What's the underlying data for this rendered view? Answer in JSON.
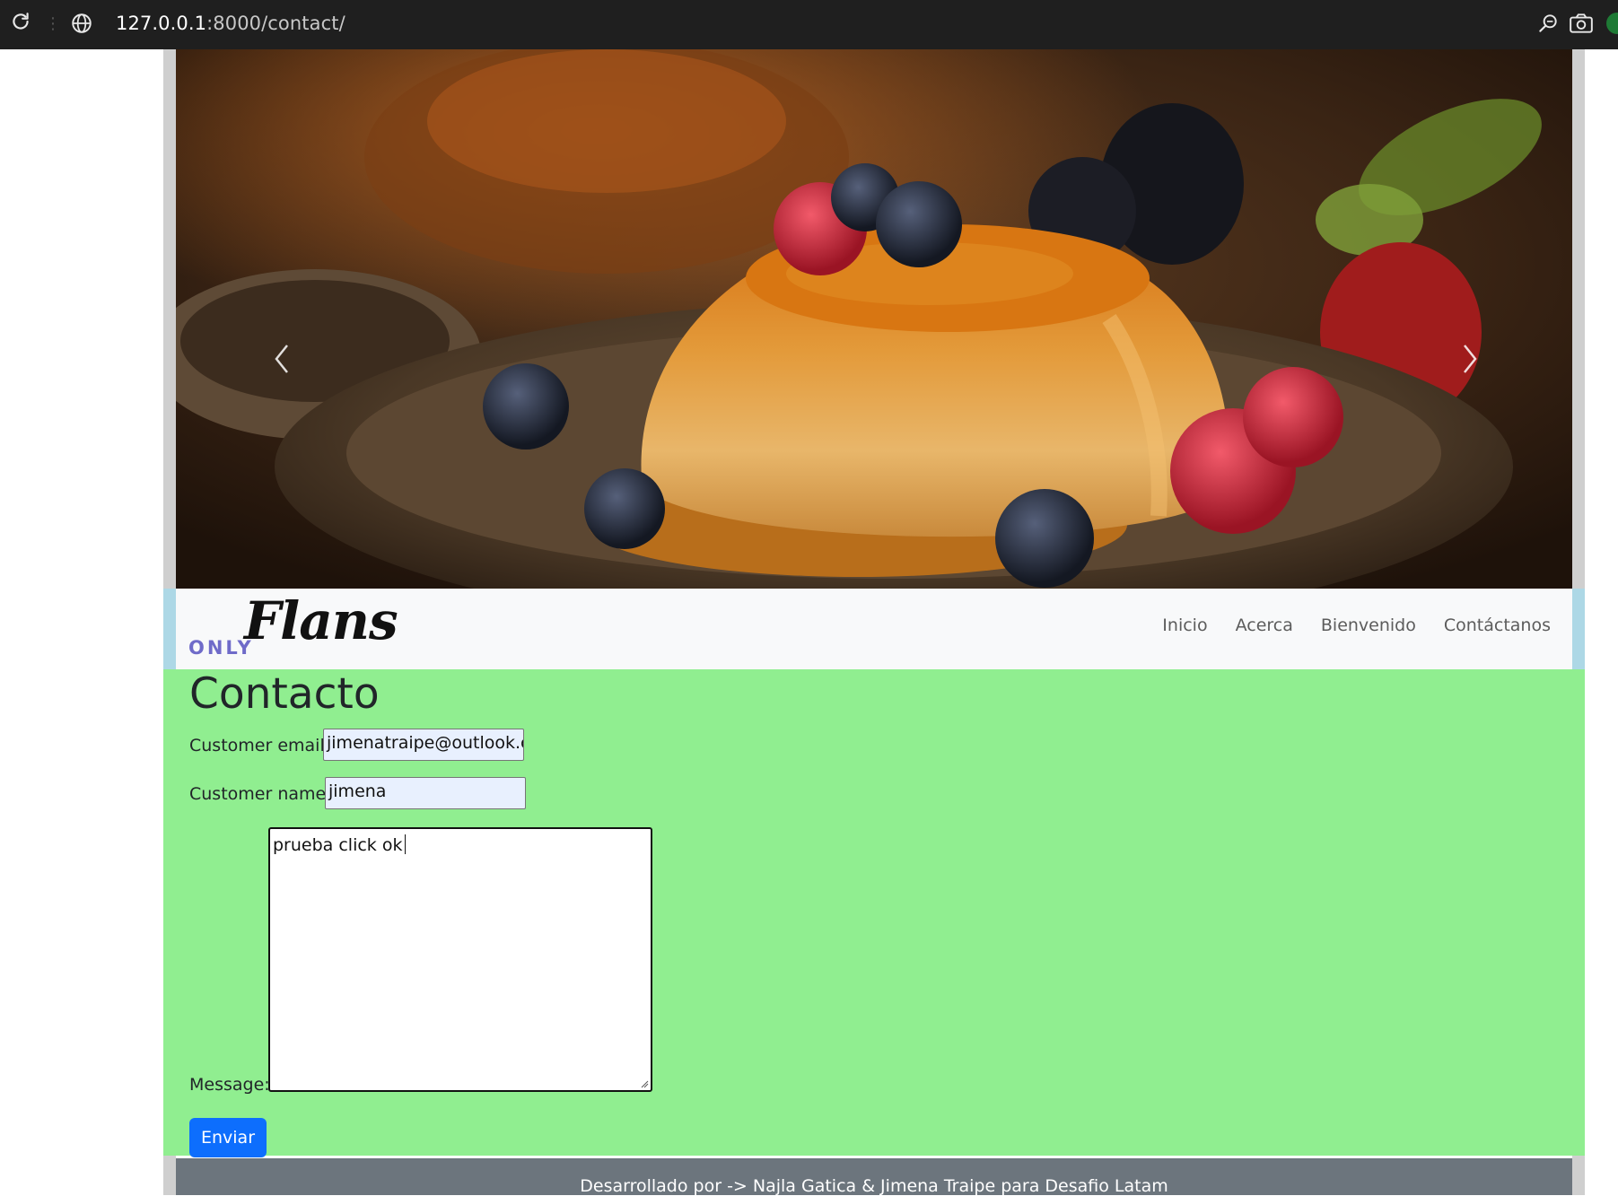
{
  "browser": {
    "url_host": "127.0.0.1",
    "url_rest": ":8000/contact/",
    "icons": [
      "reload-icon",
      "site-info-icon",
      "zoom-icon",
      "screenshot-icon",
      "extension-icon"
    ]
  },
  "carousel": {
    "image_alt": "Flan con frutos rojos",
    "prev_icon": "chevron-left-icon",
    "next_icon": "chevron-right-icon"
  },
  "navbar": {
    "brand_only": "ONLY",
    "brand_flans": "Flans",
    "links": [
      "Inicio",
      "Acerca",
      "Bienvenido",
      "Contáctanos"
    ]
  },
  "contact": {
    "title": "Contacto",
    "email_label": "Customer email:",
    "email_value": "jimenatraipe@outlook.cc",
    "name_label": "Customer name:",
    "name_value": "jimena",
    "message_label": "Message:",
    "message_value": "prueba click ok",
    "submit_label": "Enviar"
  },
  "footer": {
    "text": "Desarrollado por -> Najla Gatica & Jimena Traipe para Desafio Latam"
  },
  "colors": {
    "browser_bar": "#1f1f1f",
    "main_bg": "#90ee90",
    "navbar_side": "#add8e6",
    "button": "#0d6efd",
    "footer": "#6c757d",
    "brand_only": "#6f6bc9"
  }
}
